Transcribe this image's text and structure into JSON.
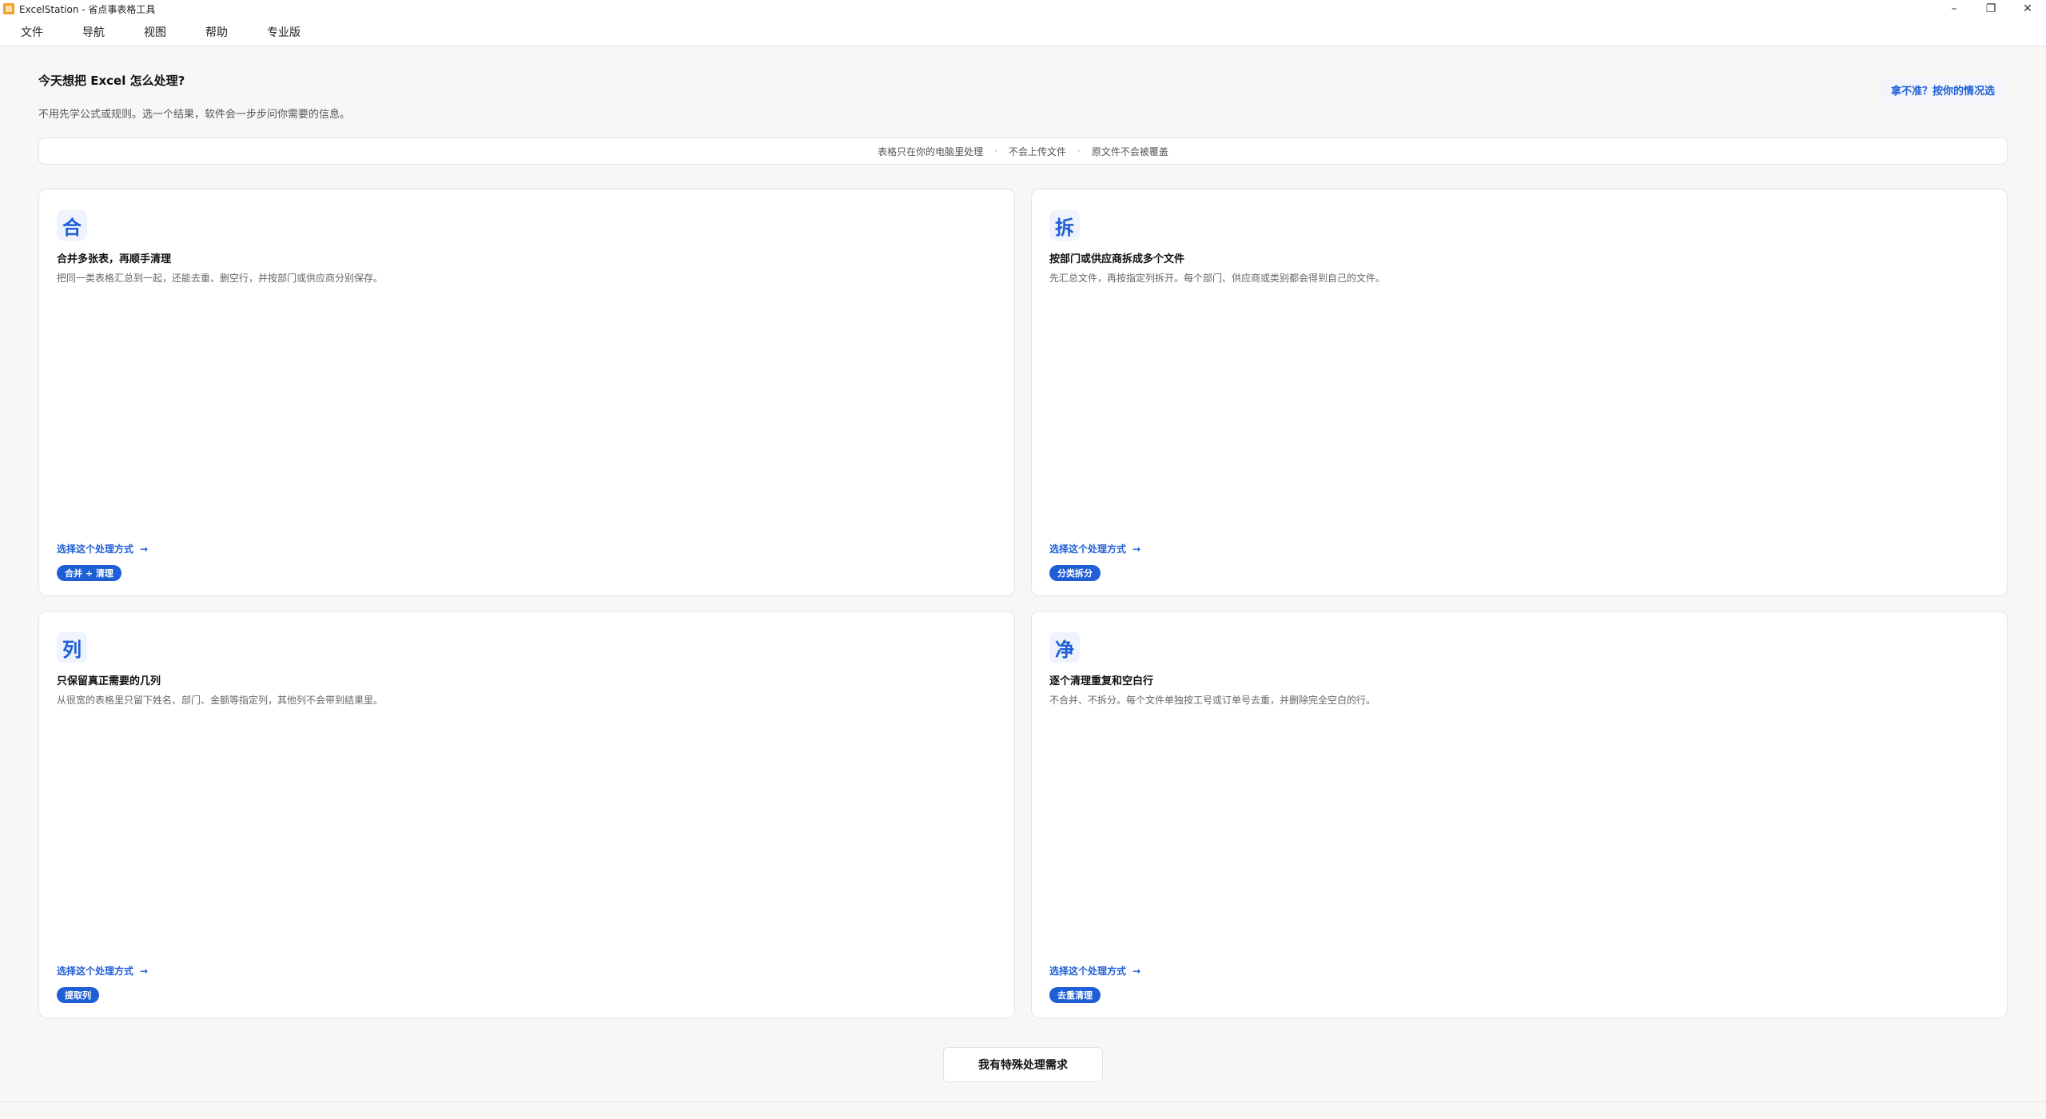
{
  "window": {
    "title": "ExcelStation - 省点事表格工具",
    "minimize": "–",
    "restore": "❐",
    "close": "✕"
  },
  "menu": {
    "items": [
      "文件",
      "导航",
      "视图",
      "帮助",
      "专业版"
    ]
  },
  "header": {
    "title": "今天想把 Excel 怎么处理?",
    "subtitle": "不用先学公式或规则。选一个结果，软件会一步步问你需要的信息。",
    "help_link": "拿不准？按你的情况选"
  },
  "privacy": {
    "items": [
      "表格只在你的电脑里处理",
      "不会上传文件",
      "原文件不会被覆盖"
    ],
    "separator": "·"
  },
  "cards": [
    {
      "glyph": "合",
      "title": "合并多张表，再顺手清理",
      "desc": "把同一类表格汇总到一起，还能去重、删空行，并按部门或供应商分别保存。",
      "action": "选择这个处理方式",
      "badge": "合并 + 清理"
    },
    {
      "glyph": "拆",
      "title": "按部门或供应商拆成多个文件",
      "desc": "先汇总文件，再按指定列拆开。每个部门、供应商或类别都会得到自己的文件。",
      "action": "选择这个处理方式",
      "badge": "分类拆分"
    },
    {
      "glyph": "列",
      "title": "只保留真正需要的几列",
      "desc": "从很宽的表格里只留下姓名、部门、金额等指定列，其他列不会带到结果里。",
      "action": "选择这个处理方式",
      "badge": "提取列"
    },
    {
      "glyph": "净",
      "title": "逐个清理重复和空白行",
      "desc": "不合并、不拆分。每个文件单独按工号或订单号去重，并删除完全空白的行。",
      "action": "选择这个处理方式",
      "badge": "去重清理"
    }
  ],
  "action_arrow": "→",
  "special_button": "我有特殊处理需求",
  "colors": {
    "accent": "#1f5fd6",
    "background": "#f7f7f6",
    "card": "#ffffff"
  }
}
